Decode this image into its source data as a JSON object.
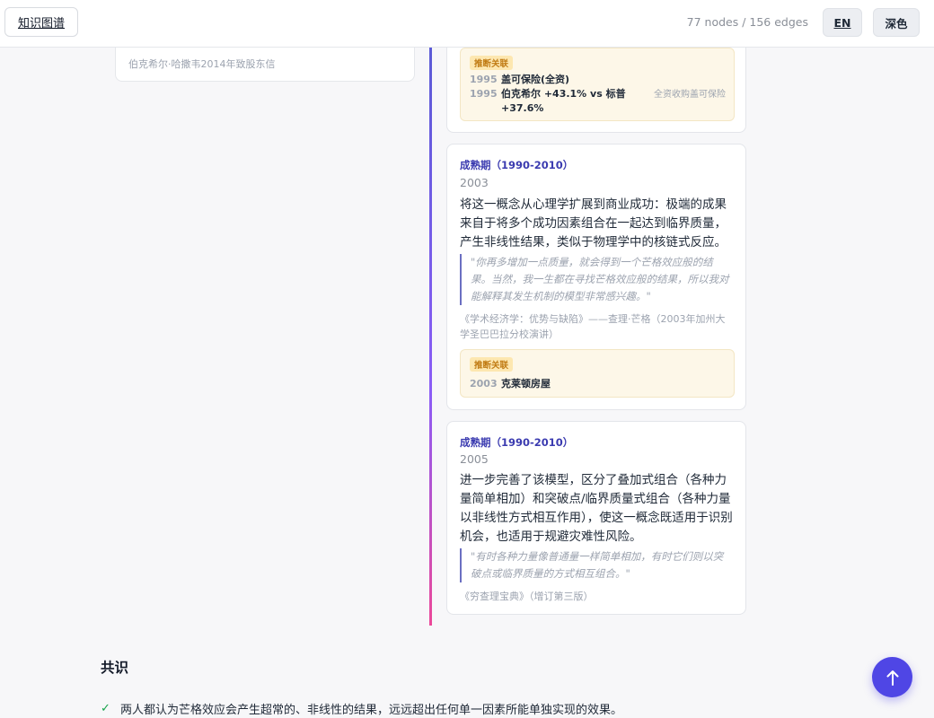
{
  "topbar": {
    "kg_label": "知识图谱",
    "stats": "77 nodes / 156 edges",
    "lang_label": "EN",
    "theme_label": "深色"
  },
  "left_card": {
    "source": "伯克希尔·哈撒韦2014年致股东信"
  },
  "cards": [
    {
      "inferred": {
        "badge": "推断关联",
        "events": [
          {
            "year": "1995",
            "text": "盖可保险(全资)",
            "note": ""
          },
          {
            "year": "1995",
            "text_line1": "伯克希尔 +43.1% vs 标普",
            "text_line2": "+37.6%",
            "note": "全资收购盖可保险"
          }
        ]
      }
    },
    {
      "era": "成熟期（1990-2010）",
      "year": "2003",
      "body": "将这一概念从心理学扩展到商业成功：极端的成果来自于将多个成功因素组合在一起达到临界质量，产生非线性结果，类似于物理学中的核链式反应。",
      "quote": "\"你再多增加一点质量，就会得到一个芒格效应般的结果。当然，我一生都在寻找芒格效应般的结果，所以我对能解释其发生机制的模型非常感兴趣。\"",
      "source": "《学术经济学：优势与缺陷》——查理·芒格（2003年加州大学圣巴巴拉分校演讲）",
      "inferred": {
        "badge": "推断关联",
        "events": [
          {
            "year": "2003",
            "text": "克莱顿房屋"
          }
        ]
      }
    },
    {
      "era": "成熟期（1990-2010）",
      "year": "2005",
      "body": "进一步完善了该模型，区分了叠加式组合（各种力量简单相加）和突破点/临界质量式组合（各种力量以非线性方式相互作用），使这一概念既适用于识别机会，也适用于规避灾难性风险。",
      "quote": "\"有时各种力量像普通量一样简单相加，有时它们则以突破点或临界质量的方式相互组合。\"",
      "source": "《穷查理宝典》（增订第三版）"
    }
  ],
  "consensus": {
    "title": "共识",
    "items": [
      "两人都认为芒格效应会产生超常的、非线性的结果，远远超出任何单一因素所能单独实现的效果。"
    ]
  },
  "fab_icon": "arrow-up-icon",
  "colors": {
    "accent": "#4f46e5",
    "era": "#3b3bb0",
    "badge_bg": "#fde7b0",
    "check": "#16a34a"
  }
}
